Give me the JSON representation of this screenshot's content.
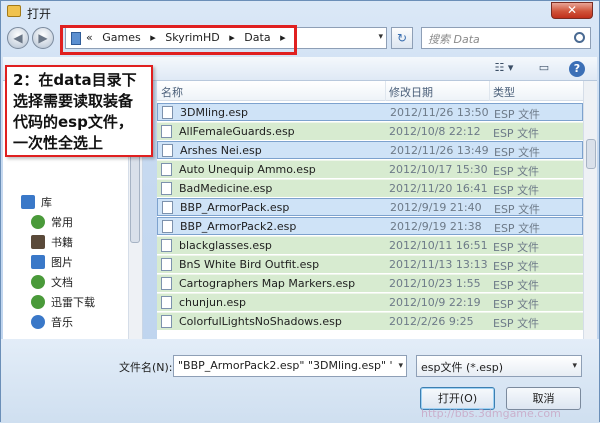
{
  "window": {
    "title": "打开",
    "close_glyph": "✕"
  },
  "nav": {
    "back_glyph": "◀",
    "forward_glyph": "▶",
    "breadcrumbs": [
      "«",
      "Games",
      "▸",
      "SkyrimHD",
      "▸",
      "Data",
      "▸"
    ],
    "dropdown_glyph": "▾",
    "refresh_glyph": "↻",
    "search_placeholder": "搜索 Data"
  },
  "toolbar": {
    "view_glyph": "☷ ▾",
    "pane_glyph": "▭",
    "help_glyph": "?"
  },
  "callout_text": "2：在data目录下选择需要读取装备代码的esp文件，一次性全选上",
  "left_pane": {
    "items": [
      {
        "label": "库",
        "icon": "library-icon",
        "color": "#3a78c8"
      },
      {
        "label": "常用",
        "icon": "user-icon",
        "color": "#4a9a3a"
      },
      {
        "label": "书籍",
        "icon": "book-icon",
        "color": "#5a4a3a"
      },
      {
        "label": "图片",
        "icon": "picture-icon",
        "color": "#3a78c8"
      },
      {
        "label": "文档",
        "icon": "document-icon",
        "color": "#4a9a3a"
      },
      {
        "label": "迅雷下载",
        "icon": "thunder-download-icon",
        "color": "#4a9a3a"
      },
      {
        "label": "音乐",
        "icon": "music-icon",
        "color": "#3a78c8"
      }
    ]
  },
  "columns": {
    "name": "名称",
    "modified": "修改日期",
    "type": "类型"
  },
  "files": [
    {
      "name": "3DMling.esp",
      "date": "2012/11/26 13:50",
      "type": "ESP 文件",
      "selected": true
    },
    {
      "name": "AllFemaleGuards.esp",
      "date": "2012/10/8 22:12",
      "type": "ESP 文件",
      "selected": false
    },
    {
      "name": "Arshes Nei.esp",
      "date": "2012/11/26 13:49",
      "type": "ESP 文件",
      "selected": true
    },
    {
      "name": "Auto Unequip Ammo.esp",
      "date": "2012/10/17 15:30",
      "type": "ESP 文件",
      "selected": false
    },
    {
      "name": "BadMedicine.esp",
      "date": "2012/11/20 16:41",
      "type": "ESP 文件",
      "selected": false
    },
    {
      "name": "BBP_ArmorPack.esp",
      "date": "2012/9/19 21:40",
      "type": "ESP 文件",
      "selected": true
    },
    {
      "name": "BBP_ArmorPack2.esp",
      "date": "2012/9/19 21:38",
      "type": "ESP 文件",
      "selected": true
    },
    {
      "name": "blackglasses.esp",
      "date": "2012/10/11 16:51",
      "type": "ESP 文件",
      "selected": false
    },
    {
      "name": "BnS White Bird Outfit.esp",
      "date": "2012/11/13 13:13",
      "type": "ESP 文件",
      "selected": false
    },
    {
      "name": "Cartographers Map Markers.esp",
      "date": "2012/10/23 1:55",
      "type": "ESP 文件",
      "selected": false
    },
    {
      "name": "chunjun.esp",
      "date": "2012/10/9 22:19",
      "type": "ESP 文件",
      "selected": false
    },
    {
      "name": "ColorfulLightsNoShadows.esp",
      "date": "2012/2/26 9:25",
      "type": "ESP 文件",
      "selected": false
    }
  ],
  "bottom": {
    "filename_label": "文件名(N):",
    "filename_value": "\"BBP_ArmorPack2.esp\" \"3DMling.esp\" \"Ar",
    "filetype_value": "esp文件 (*.esp)",
    "open_label": "打开(O)",
    "cancel_label": "取消",
    "drop_glyph": "▾"
  },
  "watermark": "http://bbs.3dmgame.com"
}
